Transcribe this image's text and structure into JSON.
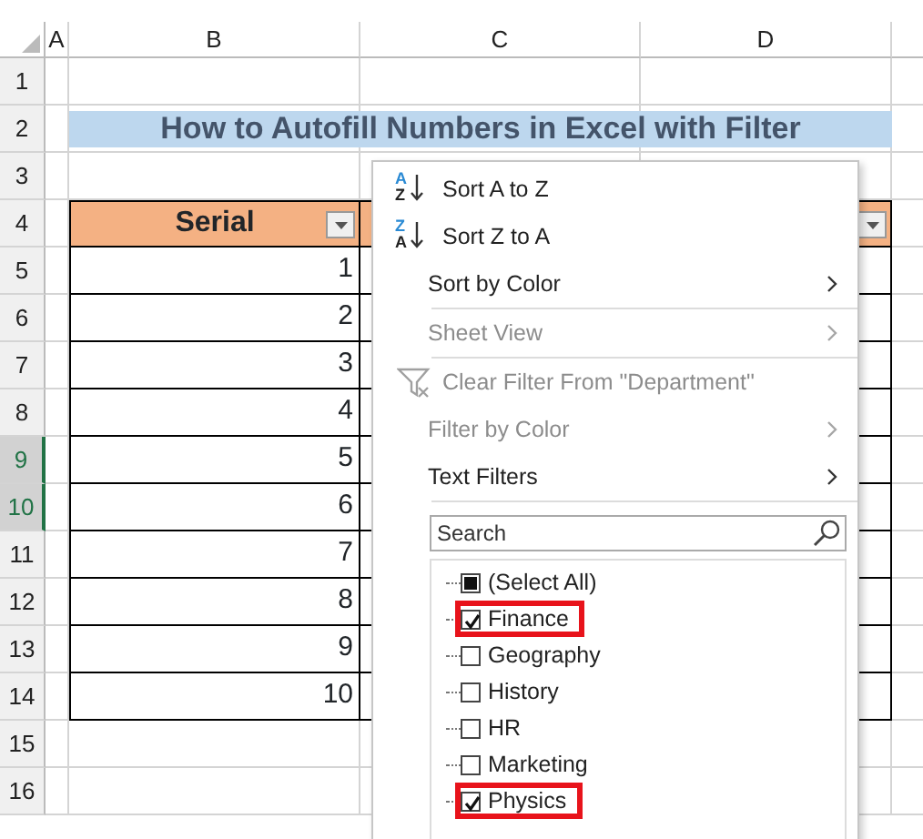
{
  "column_headers": [
    {
      "label": "A"
    },
    {
      "label": "B"
    },
    {
      "label": "C"
    },
    {
      "label": "D"
    }
  ],
  "row_headers": [
    {
      "label": "1",
      "selected": false
    },
    {
      "label": "2",
      "selected": false
    },
    {
      "label": "3",
      "selected": false
    },
    {
      "label": "4",
      "selected": false
    },
    {
      "label": "5",
      "selected": false
    },
    {
      "label": "6",
      "selected": false
    },
    {
      "label": "7",
      "selected": false
    },
    {
      "label": "8",
      "selected": false
    },
    {
      "label": "9",
      "selected": true
    },
    {
      "label": "10",
      "selected": true
    },
    {
      "label": "11",
      "selected": false
    },
    {
      "label": "12",
      "selected": false
    },
    {
      "label": "13",
      "selected": false
    },
    {
      "label": "14",
      "selected": false
    },
    {
      "label": "15",
      "selected": false
    },
    {
      "label": "16",
      "selected": false
    }
  ],
  "title": "How to Autofill Numbers in Excel with Filter",
  "table": {
    "header": "Serial",
    "rows": [
      {
        "serial": "1"
      },
      {
        "serial": "2"
      },
      {
        "serial": "3"
      },
      {
        "serial": "4"
      },
      {
        "serial": "5"
      },
      {
        "serial": "6"
      },
      {
        "serial": "7"
      },
      {
        "serial": "8"
      },
      {
        "serial": "9"
      },
      {
        "serial": "10"
      }
    ]
  },
  "filter_menu": {
    "items": [
      {
        "kind": "sort",
        "label": "Sort A to Z",
        "icon_top": "A",
        "icon_bottom": "Z",
        "disabled": false,
        "submenu": false
      },
      {
        "kind": "sort",
        "label": "Sort Z to A",
        "icon_top": "Z",
        "icon_bottom": "A",
        "disabled": false,
        "submenu": false
      },
      {
        "kind": "plain",
        "label": "Sort by Color",
        "disabled": false,
        "submenu": true
      },
      {
        "kind": "separator"
      },
      {
        "kind": "plain",
        "label": "Sheet View",
        "disabled": true,
        "submenu": true
      },
      {
        "kind": "separator"
      },
      {
        "kind": "clear",
        "label": "Clear Filter From \"Department\"",
        "disabled": true,
        "submenu": false
      },
      {
        "kind": "plain",
        "label": "Filter by Color",
        "disabled": true,
        "submenu": true
      },
      {
        "kind": "plain",
        "label": "Text Filters",
        "disabled": false,
        "submenu": true
      },
      {
        "kind": "separator"
      }
    ],
    "search": {
      "placeholder": "Search"
    },
    "values": [
      {
        "label": "(Select All)",
        "checked": false,
        "partial": true,
        "highlighted": false
      },
      {
        "label": "Finance",
        "checked": true,
        "highlighted": true
      },
      {
        "label": "Geography",
        "checked": false,
        "highlighted": false
      },
      {
        "label": "History",
        "checked": false,
        "highlighted": false
      },
      {
        "label": "HR",
        "checked": false,
        "highlighted": false
      },
      {
        "label": "Marketing",
        "checked": false,
        "highlighted": false
      },
      {
        "label": "Physics",
        "checked": true,
        "highlighted": true
      }
    ]
  }
}
